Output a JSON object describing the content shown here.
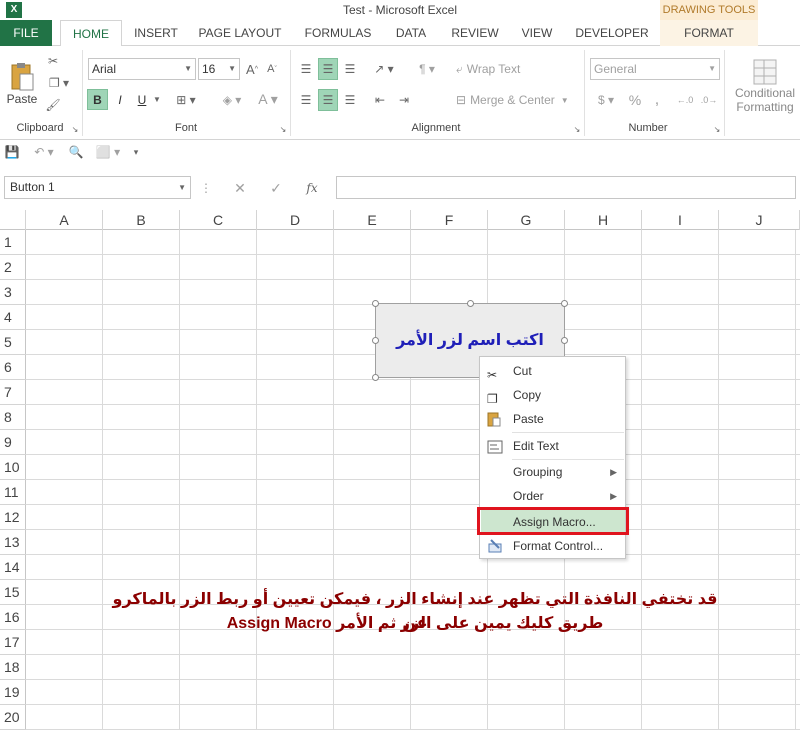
{
  "window": {
    "title": "Test - Microsoft Excel"
  },
  "contextual_tab": {
    "group": "DRAWING TOOLS",
    "tab": "FORMAT"
  },
  "tabs": [
    "FILE",
    "HOME",
    "INSERT",
    "PAGE LAYOUT",
    "FORMULAS",
    "DATA",
    "REVIEW",
    "VIEW",
    "DEVELOPER"
  ],
  "ribbon": {
    "clipboard": {
      "label": "Clipboard",
      "paste": "Paste"
    },
    "font": {
      "label": "Font",
      "name": "Arial",
      "size": "16",
      "bold": "B",
      "italic": "I",
      "underline": "U"
    },
    "alignment": {
      "label": "Alignment",
      "wrap": "Wrap Text",
      "merge": "Merge & Center"
    },
    "number": {
      "label": "Number",
      "format": "General",
      "percent": "%",
      "comma": ","
    },
    "styles": {
      "conditional": "Conditional",
      "formatting": "Formatting"
    }
  },
  "formula_bar": {
    "name_box": "Button 1",
    "fx": "fx",
    "value": ""
  },
  "columns": [
    "A",
    "B",
    "C",
    "D",
    "E",
    "F",
    "G",
    "H",
    "I",
    "J"
  ],
  "rows": [
    "1",
    "2",
    "3",
    "4",
    "5",
    "6",
    "7",
    "8",
    "9",
    "10",
    "11",
    "12",
    "13",
    "14",
    "15",
    "16",
    "17",
    "18",
    "19",
    "20"
  ],
  "form_button": {
    "label": "اكتب اسم لزر الأمر"
  },
  "context_menu": {
    "items": [
      {
        "label": "Cut",
        "icon": "scissors-icon"
      },
      {
        "label": "Copy",
        "icon": "copy-icon"
      },
      {
        "label": "Paste",
        "icon": "paste-icon"
      },
      {
        "label": "Edit Text",
        "icon": "edit-text-icon"
      },
      {
        "label": "Grouping",
        "icon": "",
        "submenu": true
      },
      {
        "label": "Order",
        "icon": "",
        "submenu": true
      },
      {
        "label": "Assign Macro...",
        "icon": "",
        "highlighted": true
      },
      {
        "label": "Format Control...",
        "icon": "format-control-icon"
      }
    ]
  },
  "annotation": {
    "line1": "قد تختفي النافذة التي تظهر عند إنشاء الزر ، فيمكن تعيين أو ربط الزر بالماكرو عن",
    "line2": "طريق كليك يمين على الزر ثم الأمر Assign Macro"
  },
  "colors": {
    "excel_green": "#217346",
    "highlight_box": "#e0141e",
    "annotation": "#8b0000",
    "button_text": "#1f1fb8"
  }
}
